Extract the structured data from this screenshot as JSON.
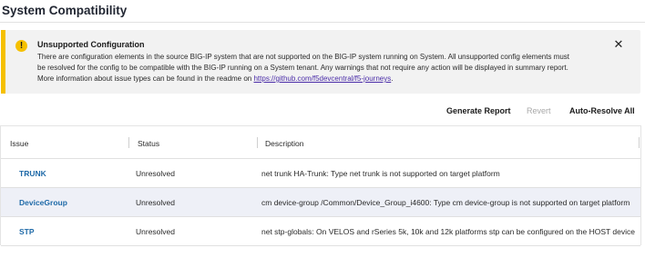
{
  "page": {
    "title": "System Compatibility"
  },
  "banner": {
    "title": "Unsupported Configuration",
    "line1": "There are configuration elements in the source BIG-IP system that are not supported on the BIG-IP system running on System. All unsupported config elements must",
    "line2": "be resolved for the config to be compatible with the BIG-IP running on a System tenant. Any warnings that not require any action will be displayed in summary report.",
    "line3_prefix": "More information about issue types can be found in the readme on ",
    "link": "https://github.com/f5devcentral/f5-journeys",
    "line3_suffix": ".",
    "close_glyph": "✕",
    "warn_glyph": "!",
    "icon": "warning-icon",
    "accent_color": "#f5c000"
  },
  "actions": {
    "generate_report": "Generate Report",
    "revert": "Revert",
    "auto_resolve": "Auto-Resolve All"
  },
  "table": {
    "columns": [
      "Issue",
      "Status",
      "Description"
    ],
    "rows": [
      {
        "issue": "TRUNK",
        "status": "Unresolved",
        "description": "net trunk HA-Trunk: Type net trunk is not supported on target platform"
      },
      {
        "issue": "DeviceGroup",
        "status": "Unresolved",
        "description": "cm device-group /Common/Device_Group_i4600: Type cm device-group is not supported on target platform"
      },
      {
        "issue": "STP",
        "status": "Unresolved",
        "description": "net stp-globals: On VELOS and rSeries 5k, 10k and 12k platforms stp can be configured on the HOST device"
      }
    ]
  }
}
